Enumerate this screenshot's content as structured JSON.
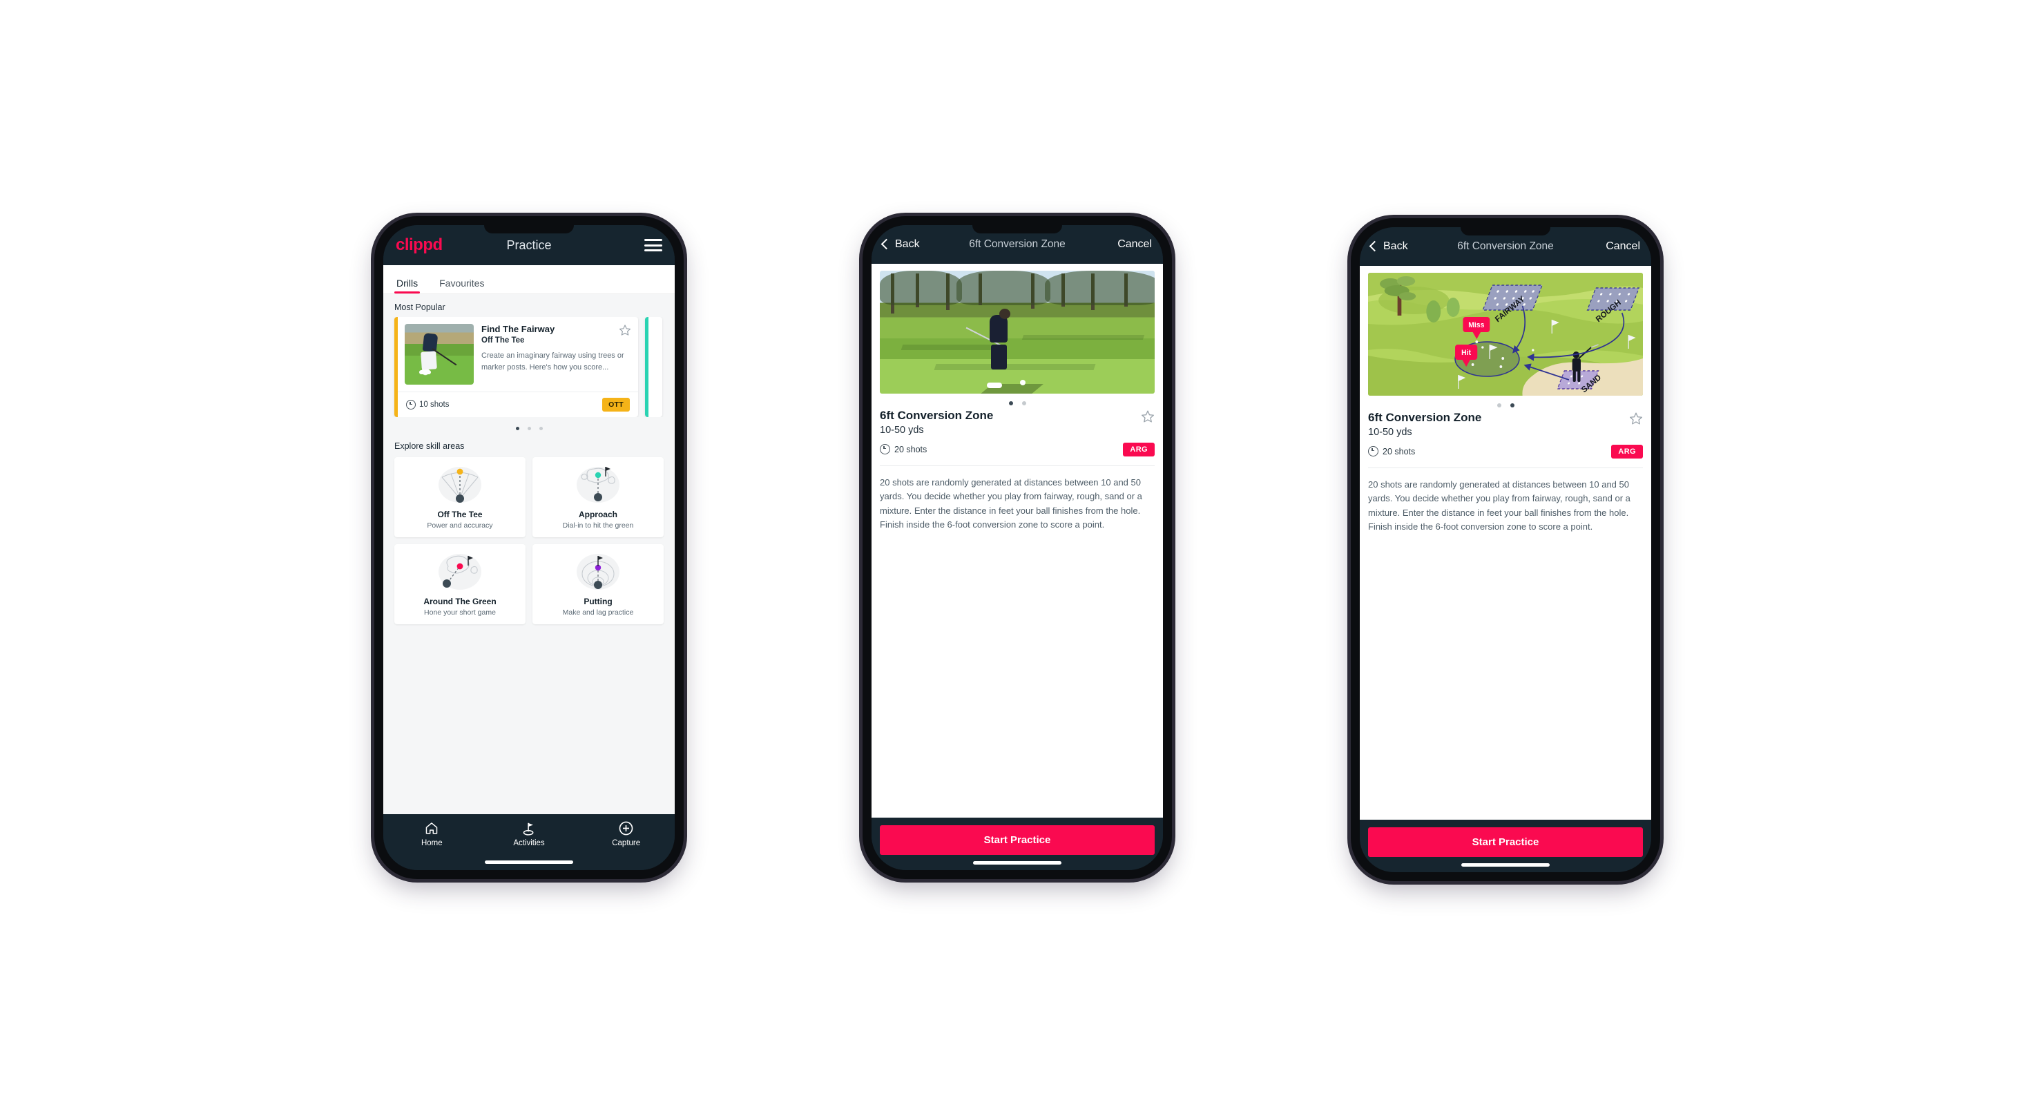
{
  "app": {
    "brand": "clippd",
    "brand_color": "#fa0a50",
    "header_bg": "#16252f"
  },
  "phone1": {
    "header": {
      "title": "Practice",
      "menu_icon": "hamburger-menu-icon"
    },
    "tabs": [
      {
        "label": "Drills",
        "active": true
      },
      {
        "label": "Favourites",
        "active": false
      }
    ],
    "most_popular": {
      "section_label": "Most Popular",
      "card": {
        "title": "Find The Fairway",
        "subtitle": "Off The Tee",
        "description": "Create an imaginary fairway using trees or marker posts. Here's how you score...",
        "shots": "10 shots",
        "badge": "OTT",
        "badge_color": "#f5b318",
        "accent_color": "#f5b318",
        "next_card_accent": "#2ad3b2",
        "star_icon": "star-outline-icon",
        "clock_icon": "clock-icon"
      },
      "dots": {
        "count": 3,
        "active_index": 0
      }
    },
    "skills": {
      "section_label": "Explore skill areas",
      "items": [
        {
          "name": "Off The Tee",
          "desc": "Power and accuracy",
          "icon": "tee-fan-icon",
          "dot_color": "#f5b318"
        },
        {
          "name": "Approach",
          "desc": "Dial-in to hit the green",
          "icon": "approach-green-icon",
          "dot_color": "#2ad3b2"
        },
        {
          "name": "Around The Green",
          "desc": "Hone your short game",
          "icon": "around-green-icon",
          "dot_color": "#fa0a50"
        },
        {
          "name": "Putting",
          "desc": "Make and lag practice",
          "icon": "putting-rings-icon",
          "dot_color": "#8e22d8"
        }
      ]
    },
    "bottom_nav": [
      {
        "label": "Home",
        "icon": "home-icon",
        "active": false
      },
      {
        "label": "Activities",
        "icon": "golf-flag-icon",
        "active": true
      },
      {
        "label": "Capture",
        "icon": "plus-circle-icon",
        "active": false
      }
    ]
  },
  "phone2": {
    "header": {
      "back": "Back",
      "title": "6ft Conversion Zone",
      "cancel": "Cancel",
      "back_icon": "chevron-left-icon"
    },
    "media": {
      "type": "photo",
      "alt_name": "golfer-chipping-photo"
    },
    "dots": {
      "count": 2,
      "active_index": 0
    },
    "detail": {
      "title": "6ft Conversion Zone",
      "distance": "10-50 yds",
      "shots": "20 shots",
      "badge": "ARG",
      "badge_color": "#fa0a50",
      "star_icon": "star-outline-icon",
      "clock_icon": "clock-icon",
      "description": "20 shots are randomly generated at distances between 10 and 50 yards. You decide whether you play from fairway, rough, sand or a mixture. Enter the distance in feet your ball finishes from the hole. Finish inside the 6-foot conversion zone to score a point."
    },
    "cta": "Start Practice"
  },
  "phone3": {
    "header": {
      "back": "Back",
      "title": "6ft Conversion Zone",
      "cancel": "Cancel",
      "back_icon": "chevron-left-icon"
    },
    "media": {
      "type": "illustration",
      "alt_name": "golf-course-diagram",
      "labels": {
        "fairway": "FAIRWAY",
        "rough": "ROUGH",
        "sand": "SAND",
        "miss": "Miss",
        "hit": "Hit"
      }
    },
    "dots": {
      "count": 2,
      "active_index": 1
    },
    "detail": {
      "title": "6ft Conversion Zone",
      "distance": "10-50 yds",
      "shots": "20 shots",
      "badge": "ARG",
      "badge_color": "#fa0a50",
      "star_icon": "star-outline-icon",
      "clock_icon": "clock-icon",
      "description": "20 shots are randomly generated at distances between 10 and 50 yards. You decide whether you play from fairway, rough, sand or a mixture. Enter the distance in feet your ball finishes from the hole. Finish inside the 6-foot conversion zone to score a point."
    },
    "cta": "Start Practice"
  }
}
